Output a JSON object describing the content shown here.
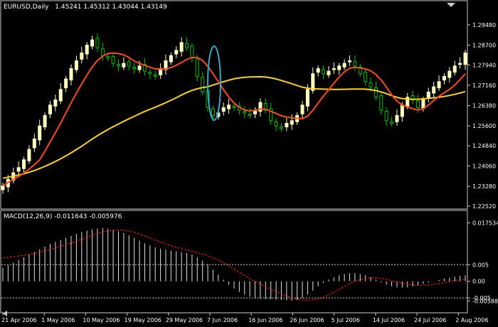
{
  "header": {
    "symbol": "EURUSD,Daily",
    "ohlc": "1.45241 1.45312 1.43044 1.43149"
  },
  "colors": {
    "background": "#000000",
    "frame": "#c8c8c8",
    "bull": "#ffffc0",
    "bear": "#00c000",
    "fast_ma": "#ff4a1a",
    "slow_ma": "#ffd21a",
    "highlight": "#39a7c9",
    "macd_hist": "#e0e0e0",
    "macd_signal": "#ff1a1a",
    "axis_text": "#ffffff"
  },
  "chart_data": [
    {
      "type": "candlestick",
      "title": "EURUSD,Daily",
      "price_ticks": [
        "1.29480",
        "1.28700",
        "1.27940",
        "1.27160",
        "1.26380",
        "1.25600",
        "1.24840",
        "1.24060",
        "1.23280",
        "1.22520"
      ],
      "ylim": [
        1.2252,
        1.3005
      ],
      "date_labels": [
        "21 Apr 2006",
        "1 May 2006",
        "10 May 2006",
        "19 May 2006",
        "29 May 2006",
        "7 Jun 2006",
        "16 Jun 2006",
        "26 Jun 2006",
        "5 Jul 2006",
        "14 Jul 2006",
        "24 Jul 2006",
        "2 Aug 2006"
      ],
      "closes": [
        1.233,
        1.2355,
        1.238,
        1.24,
        1.243,
        1.247,
        1.251,
        1.256,
        1.26,
        1.264,
        1.266,
        1.27,
        1.274,
        1.278,
        1.281,
        1.284,
        1.287,
        1.289,
        1.286,
        1.283,
        1.282,
        1.28,
        1.279,
        1.28,
        1.279,
        1.278,
        1.279,
        1.277,
        1.276,
        1.275,
        1.278,
        1.281,
        1.283,
        1.285,
        1.288,
        1.286,
        1.282,
        1.275,
        1.269,
        1.263,
        1.26,
        1.261,
        1.263,
        1.264,
        1.263,
        1.262,
        1.261,
        1.26,
        1.262,
        1.265,
        1.262,
        1.258,
        1.256,
        1.255,
        1.257,
        1.258,
        1.26,
        1.264,
        1.27,
        1.276,
        1.278,
        1.276,
        1.277,
        1.278,
        1.279,
        1.28,
        1.281,
        1.279,
        1.276,
        1.273,
        1.271,
        1.267,
        1.262,
        1.258,
        1.257,
        1.26,
        1.264,
        1.267,
        1.266,
        1.263,
        1.266,
        1.269,
        1.271,
        1.273,
        1.275,
        1.277,
        1.279,
        1.28,
        1.284
      ],
      "sma_fast_period": 8,
      "sma_slow_period": 40,
      "slow_ma_seed": 1.22
    },
    {
      "type": "histogram_line",
      "title": "MACD(12,26,9) -0.011643 -0.005976",
      "y_ticks": [
        "0.017534",
        "0.005",
        "0.00",
        "-0.005",
        "-0.005889"
      ],
      "ylim": [
        -0.0088,
        0.0185
      ],
      "levels": [
        0.005,
        -0.005
      ],
      "macd": [
        0.004,
        0.0048,
        0.0056,
        0.0064,
        0.0072,
        0.008,
        0.0088,
        0.0096,
        0.0104,
        0.0112,
        0.0118,
        0.0124,
        0.013,
        0.0136,
        0.0142,
        0.0148,
        0.0152,
        0.0156,
        0.0158,
        0.016,
        0.0158,
        0.0155,
        0.015,
        0.0145,
        0.0138,
        0.013,
        0.0122,
        0.0114,
        0.0108,
        0.0102,
        0.0098,
        0.0095,
        0.0092,
        0.009,
        0.0088,
        0.0085,
        0.008,
        0.0072,
        0.0062,
        0.005,
        0.0035,
        0.002,
        0.0005,
        -0.001,
        -0.0022,
        -0.0032,
        -0.004,
        -0.0046,
        -0.005,
        -0.0052,
        -0.0053,
        -0.0054,
        -0.0055,
        -0.0056,
        -0.0057,
        -0.0058,
        -0.0056,
        -0.005,
        -0.004,
        -0.0028,
        -0.0015,
        -0.0005,
        0.0005,
        0.0012,
        0.0018,
        0.0022,
        0.0024,
        0.0024,
        0.0022,
        0.0018,
        0.0012,
        0.0005,
        -0.0003,
        -0.001,
        -0.0015,
        -0.0018,
        -0.0019,
        -0.0018,
        -0.0015,
        -0.0012,
        -0.0008,
        -0.0004,
        0.0,
        0.0004,
        0.0008,
        0.0011,
        0.0014,
        0.0016,
        0.0018
      ],
      "signal": [
        0.007,
        0.0072,
        0.0074,
        0.0076,
        0.0078,
        0.0081,
        0.0084,
        0.0088,
        0.0092,
        0.0096,
        0.01,
        0.0105,
        0.011,
        0.0115,
        0.012,
        0.0126,
        0.0132,
        0.0138,
        0.0143,
        0.0148,
        0.0151,
        0.0153,
        0.0154,
        0.0153,
        0.0151,
        0.0147,
        0.0142,
        0.0136,
        0.013,
        0.0124,
        0.0118,
        0.0112,
        0.0107,
        0.0102,
        0.0098,
        0.0094,
        0.009,
        0.0086,
        0.0082,
        0.0077,
        0.0071,
        0.0064,
        0.0056,
        0.0047,
        0.0037,
        0.0027,
        0.0017,
        0.0008,
        0.0,
        -0.0008,
        -0.0016,
        -0.0024,
        -0.0031,
        -0.0038,
        -0.0044,
        -0.0049,
        -0.0053,
        -0.0056,
        -0.0057,
        -0.0056,
        -0.0053,
        -0.0048,
        -0.0041,
        -0.0033,
        -0.0024,
        -0.0015,
        -0.0007,
        0.0,
        0.0005,
        0.0009,
        0.0011,
        0.0011,
        0.0009,
        0.0006,
        0.0002,
        -0.0002,
        -0.0006,
        -0.0009,
        -0.0011,
        -0.0012,
        -0.0012,
        -0.0011,
        -0.0009,
        -0.0007,
        -0.0004,
        -0.0001,
        0.0002,
        0.0005,
        0.0008
      ]
    }
  ]
}
